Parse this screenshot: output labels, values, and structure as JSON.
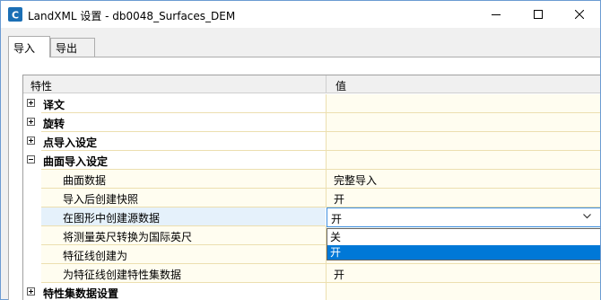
{
  "window": {
    "title": "LandXML 设置 - db0048_Surfaces_DEM",
    "icon": "civil3d-app-icon",
    "controls": [
      "minimize-icon",
      "maximize-icon",
      "close-icon"
    ]
  },
  "tabs": [
    {
      "label": "导入",
      "active": true
    },
    {
      "label": "导出",
      "active": false
    }
  ],
  "grid": {
    "headers": {
      "property": "特性",
      "value": "值"
    },
    "rows": [
      {
        "kind": "category",
        "label": "译文",
        "expanded": false,
        "value": ""
      },
      {
        "kind": "category",
        "label": "旋转",
        "expanded": false,
        "value": ""
      },
      {
        "kind": "category",
        "label": "点导入设定",
        "expanded": false,
        "value": ""
      },
      {
        "kind": "category",
        "label": "曲面导入设定",
        "expanded": true,
        "value": ""
      },
      {
        "kind": "property",
        "label": "曲面数据",
        "value": "完整导入"
      },
      {
        "kind": "property",
        "label": "导入后创建快照",
        "value": "开"
      },
      {
        "kind": "property",
        "label": "在图形中创建源数据",
        "value": "开",
        "selected": true
      },
      {
        "kind": "property",
        "label": "将测量英尺转换为国际英尺",
        "value": ""
      },
      {
        "kind": "property",
        "label": "特征线创建为",
        "value": ""
      },
      {
        "kind": "property",
        "label": "为特征线创建特性集数据",
        "value": "开"
      },
      {
        "kind": "category",
        "label": "特性集数据设置",
        "expanded": false,
        "value": ""
      }
    ]
  },
  "dropdown": {
    "selected": "开",
    "options": [
      "关",
      "开"
    ],
    "highlighted": "开"
  }
}
